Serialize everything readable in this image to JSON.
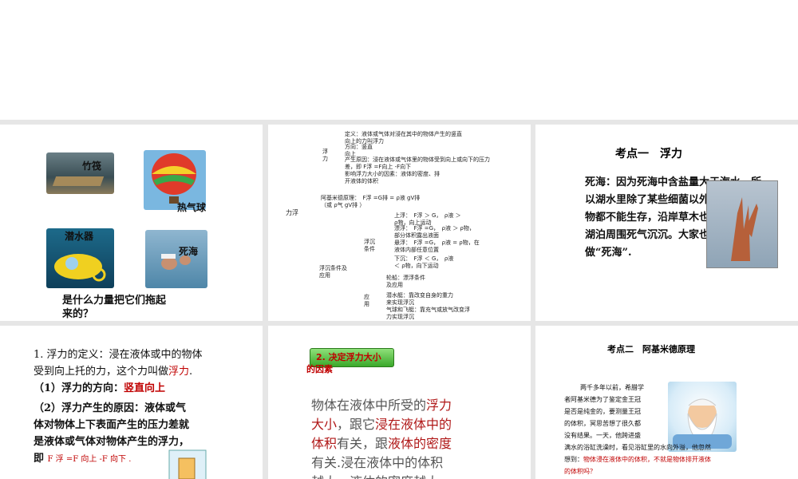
{
  "slide1": {
    "labels": [
      "竹筏",
      "热气球",
      "潜水器",
      "死海"
    ],
    "question_line1": "是什么力量把它们拖起",
    "question_line2": "来的？"
  },
  "slide2": {
    "root": "力浮",
    "branch_fu": "浮\n力",
    "def": "定义：液体或气体对浸在其中的物体产生的竖直",
    "def2": "向上的力叫浮力",
    "dir": "方向：竖直",
    "dir2": "向上",
    "cause": "产生原因：浸在液体或气体里的物体受到向上或向下的压力",
    "cause2": "差，即 F浮 =F向上 -F向下",
    "factors": "影响浮力大小的因素：液体的密度、排",
    "factors2": "开液体的体积",
    "archimedes": "阿基米德原理：　F浮 =G排 = ρ液 gV排",
    "archimedes2": "（或 ρ气 gV排 ）",
    "float_sink": "浮沉条件及",
    "float_sink2": "应用",
    "conditions": "浮沉\n条件",
    "up": "上浮：　F浮 ＞ G，　ρ液 ＞",
    "up2": "ρ物，向上运动",
    "float": "漂浮：　F浮 =G，　ρ液 ＞ ρ物，",
    "float2": "部分体积露出液面",
    "suspend": "悬浮：　F浮 =G，　ρ液 = ρ物，在",
    "suspend2": "液体内部任意位置",
    "down": "下沉：　F浮 ＜ G，　ρ液",
    "down2": "＜ ρ物，向下运动",
    "apply": "应\n用",
    "ship": "轮船：漂浮条件",
    "ship2": "及应用",
    "sub": "潜水艇：靠改变自身的重力",
    "sub2": "来实现浮沉",
    "balloon": "气球和飞艇：靠充气或放气改变浮",
    "balloon2": "力实现浮沉"
  },
  "slide3": {
    "title": "考点一　浮力",
    "lines": [
      "死海：因为死海中含盐量大于海水，所",
      "以湖水里除了某些细菌以外，其他生",
      "物都不能生存，沿岸草木也很少，",
      "湖泊周围死气沉沉。大家也把它称",
      "做“死海”."
    ]
  },
  "slide4": {
    "line1": "1. 浮力的定义：浸在液体或中的物体",
    "line2a": "受到向上托的力，这个力叫做",
    "line2b": "浮力",
    "line2c": ".",
    "line3a": "（1）浮力的方向：",
    "line3b": "竖直向上",
    "line4": "（2）浮力产生的原因：液体或气",
    "line5": "体对物体上下表面产生的压力差就",
    "line6": "是液体或气体对物体产生的浮力，",
    "line7a": "即",
    "formula": "F 浮 =F 向上 -F 向下 ."
  },
  "slide5": {
    "button": "2. 决定浮力大小",
    "button2": "的因素",
    "p1a": "物体在液体中所受的",
    "p1b": "浮力",
    "p2a": "大小",
    "p2b": "，跟它",
    "p2c": "浸在液体中的",
    "p3a": "体积",
    "p3b": "有关，跟",
    "p3c": "液体的密度",
    "p4": "有关.浸在液体中的体积",
    "p5": "越大，液体的密度越大"
  },
  "slide6": {
    "title": "考点二　阿基米德原理",
    "lines": [
      "两千多年以前，希腊学",
      "者阿基米德为了鉴定金王冠",
      "是否是纯金的，要测量王冠",
      "的体积，冥思苦想了很久都",
      "没有结果。一天，他跨进盛",
      "满水的浴缸洗澡时，看见浴缸里的水向外溢，他忽然",
      "想到："
    ],
    "red": "物体浸在液体中的体积，不就是物体排开液体",
    "red2": "的体积吗？"
  }
}
